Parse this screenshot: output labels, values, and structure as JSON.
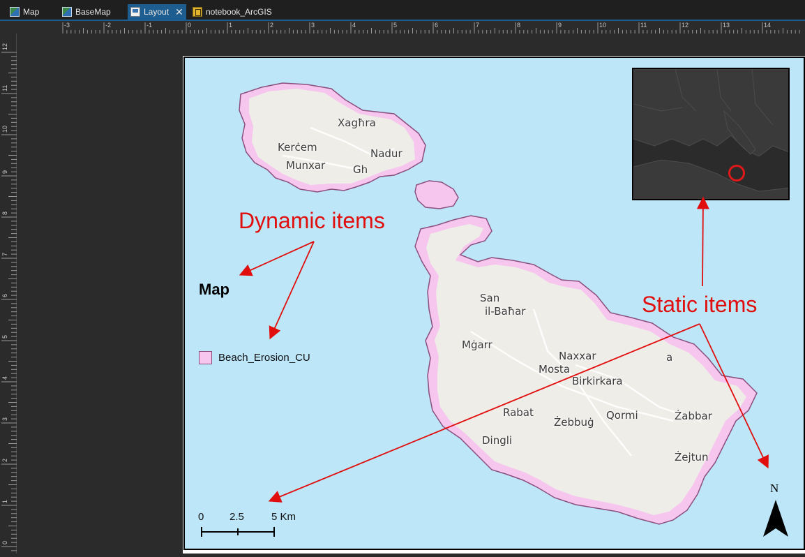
{
  "tabs": [
    {
      "label": "Map",
      "icon": "map-icon",
      "active": false
    },
    {
      "label": "BaseMap",
      "icon": "map-icon",
      "active": false
    },
    {
      "label": "Layout",
      "icon": "layout-icon",
      "active": true
    },
    {
      "label": "notebook_ArcGIS",
      "icon": "notebook-icon",
      "active": false
    }
  ],
  "ruler_top_labels": [
    "-3",
    "-2",
    "-1",
    "0",
    "1",
    "2",
    "3",
    "4",
    "5",
    "6",
    "7",
    "8",
    "9",
    "10",
    "11",
    "12",
    "13",
    "14"
  ],
  "ruler_left_labels": [
    "12",
    "11",
    "10",
    "9",
    "8",
    "7",
    "6",
    "5",
    "4",
    "3",
    "2",
    "1",
    "0"
  ],
  "places": {
    "xaghra": "Xagħra",
    "kercem": "Kerċem",
    "nadur": "Nadur",
    "munxar": "Munxar",
    "ghajnsielem": "Gh",
    "sanpawl": "San",
    "ilbahar": "il-Baħar",
    "mgarr": "Mġarr",
    "naxxar": "Naxxar",
    "mosta": "Mosta",
    "birkirkara": "Birkirkara",
    "rabat": "Rabat",
    "zebbug": "Żebbuġ",
    "qormi": "Qormi",
    "zabbar": "Żabbar",
    "dingli": "Dingli",
    "zejtun": "Żejtun",
    "sliema_fragment": "a"
  },
  "layout": {
    "map_title": "Map",
    "legend_label": "Beach_Erosion_CU",
    "scale_labels": [
      "0",
      "2.5",
      "5 Km"
    ],
    "north_label": "N"
  },
  "annotations": {
    "dynamic": "Dynamic items",
    "static": "Static items"
  },
  "colors": {
    "sea": "#bde6f9",
    "land": "#efede8",
    "erosion_fill": "#f6c6ee",
    "erosion_stroke": "#8a4f7d",
    "annotation_red": "#e10e0e",
    "active_tab": "#1e5d8f",
    "overview_marker": "#e01818"
  }
}
